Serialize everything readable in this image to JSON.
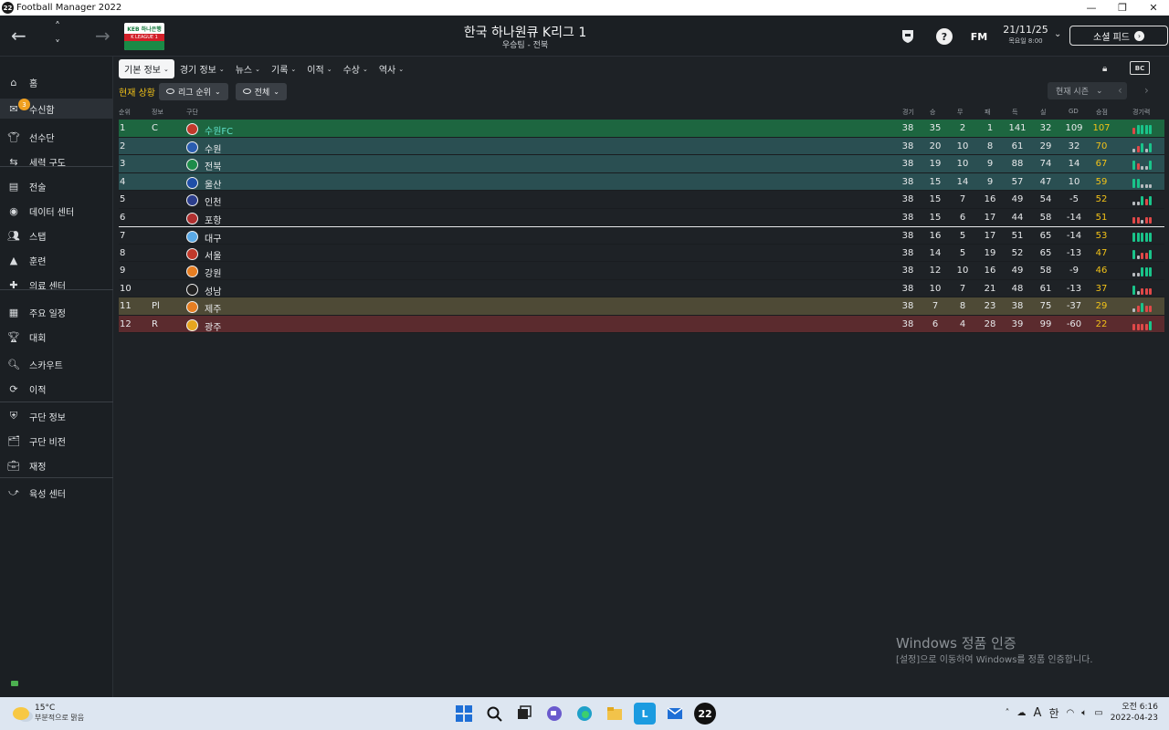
{
  "window": {
    "app_title": "Football Manager 2022",
    "app_icon_text": "22"
  },
  "header": {
    "title": "한국 하나원큐 K리그 1",
    "subtitle": "우승팀 - 전북",
    "date": "21/11/25",
    "day": "목요일 8:00",
    "social_button": "소셜 피드",
    "fm_label": "FM",
    "logo_top": "KEB 하나은행",
    "logo_band": "K LEAGUE 1",
    "icons": [
      "back-arrow-icon",
      "up-arrow-icon",
      "down-arrow-icon",
      "forward-arrow-icon",
      "club-crest-icon",
      "help-icon"
    ]
  },
  "sidebar": {
    "inbox_badge": "3",
    "items": [
      {
        "label": "홈",
        "icon": "home-icon"
      },
      {
        "label": "수신함",
        "icon": "inbox-icon"
      },
      {
        "label": "선수단",
        "icon": "shirt-icon"
      },
      {
        "label": "세력 구도",
        "icon": "dynamics-icon"
      },
      {
        "label": "전술",
        "icon": "tactics-icon"
      },
      {
        "label": "데이터 센터",
        "icon": "data-icon"
      },
      {
        "label": "스탭",
        "icon": "staff-icon"
      },
      {
        "label": "훈련",
        "icon": "training-icon"
      },
      {
        "label": "의료 센터",
        "icon": "medical-icon"
      },
      {
        "label": "주요 일정",
        "icon": "calendar-icon"
      },
      {
        "label": "대회",
        "icon": "trophy-icon"
      },
      {
        "label": "스카우트",
        "icon": "scout-icon"
      },
      {
        "label": "이적",
        "icon": "transfer-icon"
      },
      {
        "label": "구단 정보",
        "icon": "club-info-icon"
      },
      {
        "label": "구단 비전",
        "icon": "vision-icon"
      },
      {
        "label": "재정",
        "icon": "finance-icon"
      },
      {
        "label": "육성 센터",
        "icon": "development-icon"
      }
    ]
  },
  "tabs": [
    "기본 정보",
    "경기 정보",
    "뉴스",
    "기록",
    "이적",
    "수상",
    "역사"
  ],
  "filters": {
    "current_label": "현재 상황",
    "league_pill": "리그 순위",
    "all_pill": "전체",
    "season": "현재 시즌"
  },
  "table": {
    "headers": [
      "순위",
      "정보",
      "구단",
      "경기",
      "승",
      "무",
      "패",
      "득",
      "실",
      "GD",
      "승점",
      "경기력"
    ],
    "rows": [
      {
        "pos": "1",
        "info": "C",
        "club": "수원FC",
        "p": "38",
        "w": "35",
        "d": "2",
        "l": "1",
        "gf": "141",
        "ga": "32",
        "gd": "109",
        "pts": "107",
        "form": "LWWWW",
        "crest": "#c0392b",
        "band": "#1d6640"
      },
      {
        "pos": "2",
        "info": "",
        "club": "수원",
        "p": "38",
        "w": "20",
        "d": "10",
        "l": "8",
        "gf": "61",
        "ga": "29",
        "gd": "32",
        "pts": "70",
        "form": "DLWDW",
        "crest": "#2a5db0",
        "band": "#2a4f52"
      },
      {
        "pos": "3",
        "info": "",
        "club": "전북",
        "p": "38",
        "w": "19",
        "d": "10",
        "l": "9",
        "gf": "88",
        "ga": "74",
        "gd": "14",
        "pts": "67",
        "form": "WLDDW",
        "crest": "#1e8c4a",
        "band": "#2a4f52"
      },
      {
        "pos": "4",
        "info": "",
        "club": "울산",
        "p": "38",
        "w": "15",
        "d": "14",
        "l": "9",
        "gf": "57",
        "ga": "47",
        "gd": "10",
        "pts": "59",
        "form": "WWDDD",
        "crest": "#1f4fa8",
        "band": "#2a4f52"
      },
      {
        "pos": "5",
        "info": "",
        "club": "인천",
        "p": "38",
        "w": "15",
        "d": "7",
        "l": "16",
        "gf": "49",
        "ga": "54",
        "gd": "-5",
        "pts": "52",
        "form": "DDWLW",
        "crest": "#2c3e8c",
        "band": ""
      },
      {
        "pos": "6",
        "info": "",
        "club": "포항",
        "p": "38",
        "w": "15",
        "d": "6",
        "l": "17",
        "gf": "44",
        "ga": "58",
        "gd": "-14",
        "pts": "51",
        "form": "LLDLL",
        "crest": "#b03030",
        "band": ""
      },
      {
        "pos": "7",
        "info": "",
        "club": "대구",
        "p": "38",
        "w": "16",
        "d": "5",
        "l": "17",
        "gf": "51",
        "ga": "65",
        "gd": "-14",
        "pts": "53",
        "form": "WWWWW",
        "crest": "#5aa9e6",
        "band": ""
      },
      {
        "pos": "8",
        "info": "",
        "club": "서울",
        "p": "38",
        "w": "14",
        "d": "5",
        "l": "19",
        "gf": "52",
        "ga": "65",
        "gd": "-13",
        "pts": "47",
        "form": "WDLLW",
        "crest": "#c0392b",
        "band": ""
      },
      {
        "pos": "9",
        "info": "",
        "club": "강원",
        "p": "38",
        "w": "12",
        "d": "10",
        "l": "16",
        "gf": "49",
        "ga": "58",
        "gd": "-9",
        "pts": "46",
        "form": "DDWWW",
        "crest": "#e67e22",
        "band": ""
      },
      {
        "pos": "10",
        "info": "",
        "club": "성남",
        "p": "38",
        "w": "10",
        "d": "7",
        "l": "21",
        "gf": "48",
        "ga": "61",
        "gd": "-13",
        "pts": "37",
        "form": "WDLLL",
        "crest": "#222",
        "band": ""
      },
      {
        "pos": "11",
        "info": "Pl",
        "club": "제주",
        "p": "38",
        "w": "7",
        "d": "8",
        "l": "23",
        "gf": "38",
        "ga": "75",
        "gd": "-37",
        "pts": "29",
        "form": "DLWLL",
        "crest": "#e67e22",
        "band": "#4e4a36"
      },
      {
        "pos": "12",
        "info": "R",
        "club": "광주",
        "p": "38",
        "w": "6",
        "d": "4",
        "l": "28",
        "gf": "39",
        "ga": "99",
        "gd": "-60",
        "pts": "22",
        "form": "LLLLW",
        "crest": "#e6a520",
        "band": "#5b2b2e"
      }
    ]
  },
  "watermark": {
    "title": "Windows 정품 인증",
    "sub": "[설정]으로 이동하여 Windows를 정품 인증합니다."
  },
  "taskbar": {
    "temp": "15°C",
    "weather": "부분적으로 맑음",
    "time": "오전 6:16",
    "date": "2022-04-23",
    "ime_a": "A",
    "ime_lang": "한",
    "fm_icon_text": "22"
  },
  "colors": {
    "win": "#19c48a",
    "draw": "#b8bcc0",
    "loss": "#e04848",
    "points": "#f2c218"
  }
}
